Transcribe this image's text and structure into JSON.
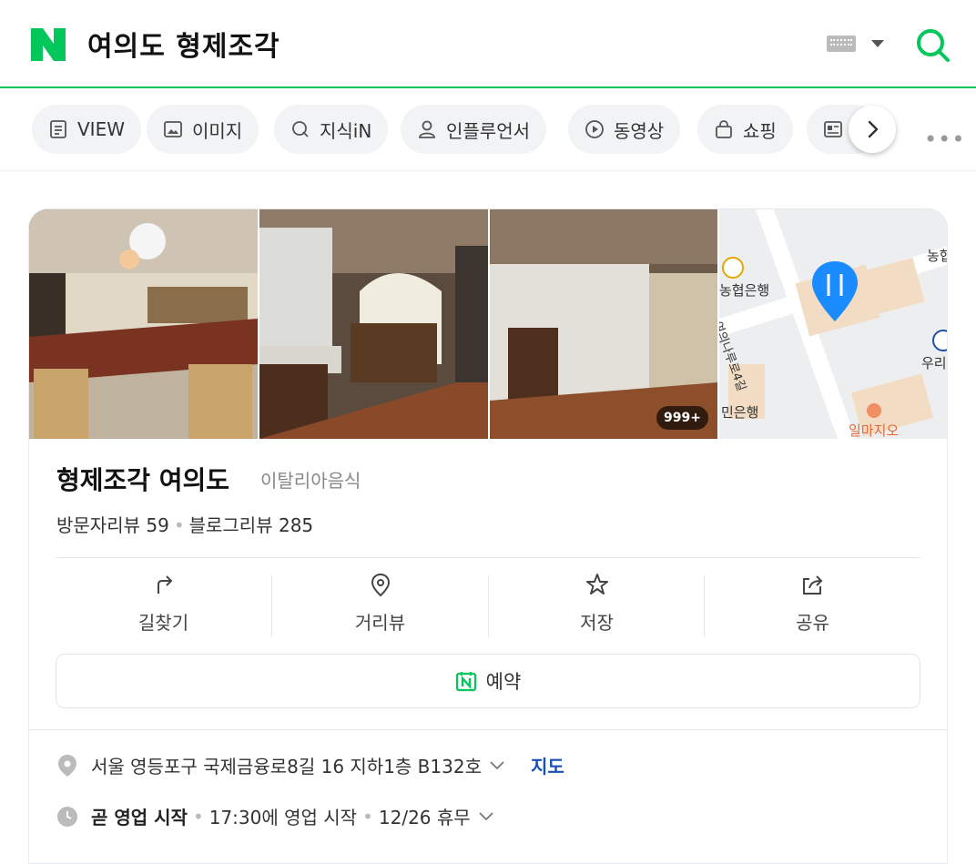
{
  "header": {
    "logo": "N",
    "query": "여의도 형제조각"
  },
  "tabs": [
    {
      "label": "VIEW",
      "icon": "document-icon"
    },
    {
      "label": "이미지",
      "icon": "image-icon"
    },
    {
      "label": "지식iN",
      "icon": "q-icon"
    },
    {
      "label": "인플루언서",
      "icon": "person-icon"
    },
    {
      "label": "동영상",
      "icon": "play-icon"
    },
    {
      "label": "쇼핑",
      "icon": "bag-icon"
    }
  ],
  "photos": {
    "count_badge": "999+"
  },
  "map": {
    "labels": [
      "농협은행",
      "여의나루로4길",
      "농협",
      "우리",
      "일마지오",
      "민은행"
    ]
  },
  "place": {
    "name": "형제조각 여의도",
    "category": "이탈리아음식",
    "visitor_review_label": "방문자리뷰",
    "visitor_review_count": "59",
    "blog_review_label": "블로그리뷰",
    "blog_review_count": "285"
  },
  "actions": [
    {
      "label": "길찾기",
      "icon": "directions-icon"
    },
    {
      "label": "거리뷰",
      "icon": "streetview-icon"
    },
    {
      "label": "저장",
      "icon": "star-icon"
    },
    {
      "label": "공유",
      "icon": "share-icon"
    }
  ],
  "reserve": {
    "label": "예약"
  },
  "info": {
    "address": "서울 영등포구 국제금융로8길 16 지하1층 B132호",
    "map_link": "지도",
    "status": "곧 영업 시작",
    "hours": "17:30에 영업 시작",
    "holiday": "12/26 휴무"
  },
  "colors": {
    "brand": "#03c75a",
    "link": "#1a4fb8"
  }
}
